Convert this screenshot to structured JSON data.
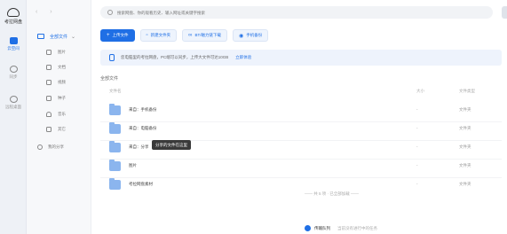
{
  "brand": {
    "name": "考拉网盘"
  },
  "rail": [
    {
      "label": "云空间"
    },
    {
      "label": "同步"
    },
    {
      "label": "远程桌面"
    }
  ],
  "sidebar": {
    "nav": "‹  ›",
    "root": {
      "label": "全部文件",
      "collapse": "⌄"
    },
    "items": [
      {
        "label": "图片"
      },
      {
        "label": "文档"
      },
      {
        "label": "视频"
      },
      {
        "label": "种子"
      },
      {
        "label": "音乐"
      },
      {
        "label": "其它"
      }
    ],
    "share": {
      "label": "我的分享"
    }
  },
  "search": {
    "placeholder": "搜索网盘、你的观看历史、输入网址或关键字搜索"
  },
  "toolbar": {
    "upload": "上传文件",
    "new_folder": "新建文件夹",
    "offline": "BT/磁力链下载",
    "backup": "手机备份"
  },
  "notice": {
    "text": "您电脑里的考拉网盘，PC端可以同步，上传大文件可达10GB",
    "link": "立即体验"
  },
  "breadcrumb": "全部文件",
  "table": {
    "columns": {
      "name": "文件名",
      "size": "大小",
      "type": "文件类型"
    },
    "rows": [
      {
        "name": "来自：手机备份",
        "size": "-",
        "type": "文件夹"
      },
      {
        "name": "来自：电脑备份",
        "size": "-",
        "type": "文件夹"
      },
      {
        "name": "来自：分享",
        "size": "-",
        "type": "文件夹"
      },
      {
        "name": "图片",
        "size": "-",
        "type": "文件夹"
      },
      {
        "name": "考拉网盘素材",
        "size": "-",
        "type": "文件夹"
      }
    ]
  },
  "tooltip": "分享的文件在这里",
  "end_note": "—— 共 5 项 · 已全部加载 ——",
  "bottom_bar": {
    "title": "传输队列",
    "subtitle": "当前没有进行中的任务"
  },
  "colors": {
    "accent": "#1f6fe5",
    "folder": "#8bb5ee"
  }
}
